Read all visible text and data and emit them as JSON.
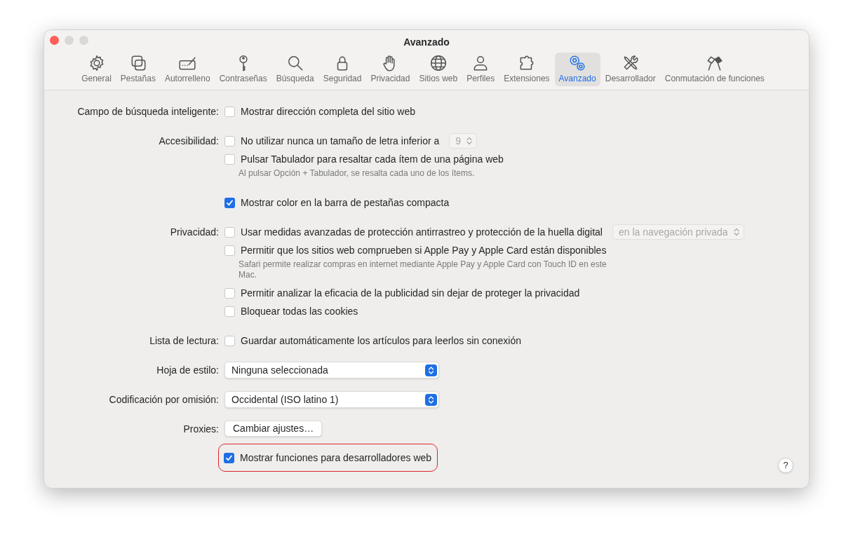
{
  "window": {
    "title": "Avanzado"
  },
  "toolbar": [
    {
      "label": "General",
      "selected": false
    },
    {
      "label": "Pestañas",
      "selected": false
    },
    {
      "label": "Autorrelleno",
      "selected": false
    },
    {
      "label": "Contraseñas",
      "selected": false
    },
    {
      "label": "Búsqueda",
      "selected": false
    },
    {
      "label": "Seguridad",
      "selected": false
    },
    {
      "label": "Privacidad",
      "selected": false
    },
    {
      "label": "Sitios web",
      "selected": false
    },
    {
      "label": "Perfiles",
      "selected": false
    },
    {
      "label": "Extensiones",
      "selected": false
    },
    {
      "label": "Avanzado",
      "selected": true
    },
    {
      "label": "Desarrollador",
      "selected": false
    },
    {
      "label": "Conmutación de funciones",
      "selected": false
    }
  ],
  "groups": [
    {
      "label": "Campo de búsqueda inteligente:",
      "items": [
        {
          "kind": "checkbox",
          "label": "Mostrar dirección completa del sitio web",
          "checked": false
        }
      ]
    },
    {
      "label": "Accesibilidad:",
      "items": [
        {
          "kind": "checkbox",
          "label": "No utilizar nunca un tamaño de letra inferior a",
          "checked": false,
          "popup": {
            "value": "9",
            "disabled": true
          }
        },
        {
          "kind": "checkbox",
          "label": "Pulsar Tabulador para resaltar cada ítem de una página web",
          "checked": false
        },
        {
          "kind": "note",
          "text": "Al pulsar Opción + Tabulador, se resalta cada uno de los ítems."
        }
      ]
    },
    {
      "items": [
        {
          "kind": "checkbox",
          "label": "Mostrar color en la barra de pestañas compacta",
          "checked": true
        }
      ]
    },
    {
      "label": "Privacidad:",
      "items": [
        {
          "kind": "checkbox",
          "label": "Usar medidas avanzadas de protección antirrastreo y protección de la huella digital",
          "checked": false,
          "popup": {
            "value": "en la navegación privada",
            "disabled": true
          }
        },
        {
          "kind": "checkbox",
          "label": "Permitir que los sitios web comprueben si Apple Pay y Apple Card están disponibles",
          "checked": false
        },
        {
          "kind": "note",
          "text": "Safari permite realizar compras en internet mediante Apple Pay y Apple Card con Touch ID en este Mac."
        },
        {
          "kind": "checkbox",
          "label": "Permitir analizar la eficacia de la publicidad sin dejar de proteger la privacidad",
          "checked": false
        },
        {
          "kind": "checkbox",
          "label": "Bloquear todas las cookies",
          "checked": false
        }
      ]
    },
    {
      "label": "Lista de lectura:",
      "items": [
        {
          "kind": "checkbox",
          "label": "Guardar automáticamente los artículos para leerlos sin conexión",
          "checked": false
        }
      ]
    },
    {
      "label": "Hoja de estilo:",
      "items": [
        {
          "kind": "select",
          "value": "Ninguna seleccionada"
        }
      ]
    },
    {
      "label": "Codificación por omisión:",
      "items": [
        {
          "kind": "select",
          "value": "Occidental (ISO latino 1)"
        }
      ]
    },
    {
      "label": "Proxies:",
      "items": [
        {
          "kind": "button",
          "label": "Cambiar ajustes…"
        }
      ]
    },
    {
      "items": [
        {
          "kind": "checkbox",
          "label": "Mostrar funciones para desarrolladores web",
          "checked": true,
          "highlighted": true
        }
      ]
    }
  ],
  "help_button": "?"
}
